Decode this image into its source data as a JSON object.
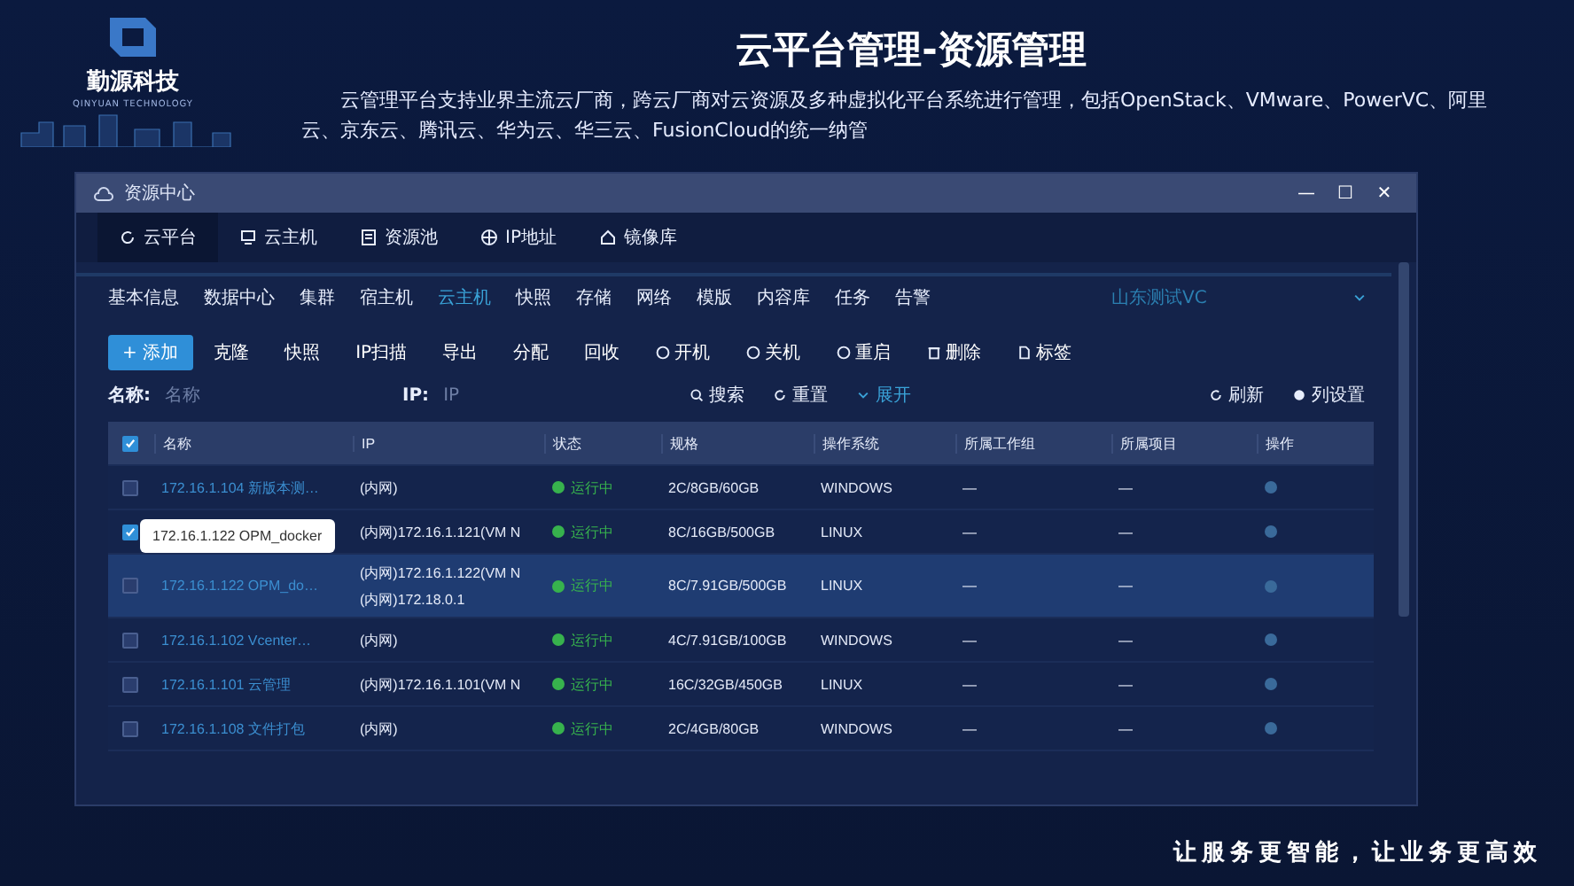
{
  "brand": {
    "name": "勤源科技",
    "tagline": "QINYUAN TECHNOLOGY"
  },
  "heading": {
    "title": "云平台管理-资源管理",
    "description": "云管理平台支持业界主流云厂商，跨云厂商对云资源及多种虚拟化平台系统进行管理，包括OpenStack、VMware、PowerVC、阿里云、京东云、腾讯云、华为云、华三云、FusionCloud的统一纳管"
  },
  "window": {
    "title": "资源中心",
    "controls": [
      "—",
      "☐",
      "✕"
    ]
  },
  "top_tabs": [
    {
      "label": "云平台",
      "selected": true
    },
    {
      "label": "云主机",
      "selected": false
    },
    {
      "label": "资源池",
      "selected": false
    },
    {
      "label": "IP地址",
      "selected": false
    },
    {
      "label": "镜像库",
      "selected": false
    }
  ],
  "sub_tabs": [
    {
      "label": "基本信息",
      "selected": false
    },
    {
      "label": "数据中心",
      "selected": false
    },
    {
      "label": "集群",
      "selected": false
    },
    {
      "label": "宿主机",
      "selected": false
    },
    {
      "label": "云主机",
      "selected": true
    },
    {
      "label": "快照",
      "selected": false
    },
    {
      "label": "存储",
      "selected": false
    },
    {
      "label": "网络",
      "selected": false
    },
    {
      "label": "模版",
      "selected": false
    },
    {
      "label": "内容库",
      "selected": false
    },
    {
      "label": "任务",
      "selected": false
    },
    {
      "label": "告警",
      "selected": false
    }
  ],
  "platform_select": {
    "value": "山东测试VC"
  },
  "toolbar": [
    {
      "label": "+ 添加",
      "kind": "primary"
    },
    {
      "label": "克隆",
      "kind": "plain"
    },
    {
      "label": "快照",
      "kind": "plain"
    },
    {
      "label": "IP扫描",
      "kind": "plain"
    },
    {
      "label": "导出",
      "kind": "plain"
    },
    {
      "label": "分配",
      "kind": "plain"
    },
    {
      "label": "回收",
      "kind": "plain"
    },
    {
      "label": "开机",
      "kind": "power"
    },
    {
      "label": "关机",
      "kind": "power"
    },
    {
      "label": "重启",
      "kind": "power"
    },
    {
      "label": "删除",
      "kind": "delete"
    },
    {
      "label": "标签",
      "kind": "tag"
    }
  ],
  "search": {
    "name_label": "名称:",
    "name_placeholder": "名称",
    "ip_label": "IP:",
    "ip_placeholder": "IP",
    "buttons": [
      {
        "label": "搜索",
        "kind": "search"
      },
      {
        "label": "重置",
        "kind": "reset"
      },
      {
        "label": "展开",
        "kind": "expand"
      }
    ],
    "right_buttons": [
      {
        "label": "刷新",
        "kind": "reset"
      },
      {
        "label": "列设置",
        "kind": "gear"
      }
    ]
  },
  "table": {
    "all_checked": true,
    "columns": [
      "名称",
      "IP",
      "状态",
      "规格",
      "操作系统",
      "所属工作组",
      "所属项目",
      "操作"
    ],
    "rows": [
      {
        "checked": false,
        "selected": false,
        "name": "172.16.1.104 新版本测…",
        "ip": [
          "(内网)"
        ],
        "status": "运行中",
        "spec": "2C/8GB/60GB",
        "os": "WINDOWS",
        "group": "—",
        "project": "—"
      },
      {
        "checked": true,
        "selected": false,
        "ip": [
          "(内网)172.16.1.121(VM N"
        ],
        "status": "运行中",
        "spec": "8C/16GB/500GB",
        "os": "LINUX",
        "group": "—",
        "project": "—"
      },
      {
        "checked": false,
        "selected": true,
        "name": "172.16.1.122 OPM_do…",
        "ip": [
          "(内网)172.16.1.122(VM N",
          "(内网)172.18.0.1"
        ],
        "status": "运行中",
        "spec": "8C/7.91GB/500GB",
        "os": "LINUX",
        "group": "—",
        "project": "—"
      },
      {
        "checked": false,
        "selected": false,
        "name": "172.16.1.102 Vcenter…",
        "ip": [
          "(内网)"
        ],
        "status": "运行中",
        "spec": "4C/7.91GB/100GB",
        "os": "WINDOWS",
        "group": "—",
        "project": "—"
      },
      {
        "checked": false,
        "selected": false,
        "name": "172.16.1.101 云管理",
        "ip": [
          "(内网)172.16.1.101(VM N"
        ],
        "status": "运行中",
        "spec": "16C/32GB/450GB",
        "os": "LINUX",
        "group": "—",
        "project": "—"
      },
      {
        "checked": false,
        "selected": false,
        "name": "172.16.1.108 文件打包",
        "ip": [
          "(内网)"
        ],
        "status": "运行中",
        "spec": "2C/4GB/80GB",
        "os": "WINDOWS",
        "group": "—",
        "project": "—"
      }
    ],
    "tooltip": {
      "text": "172.16.1.122 OPM_docker"
    }
  },
  "slogan": "让服务更智能，让业务更高效"
}
